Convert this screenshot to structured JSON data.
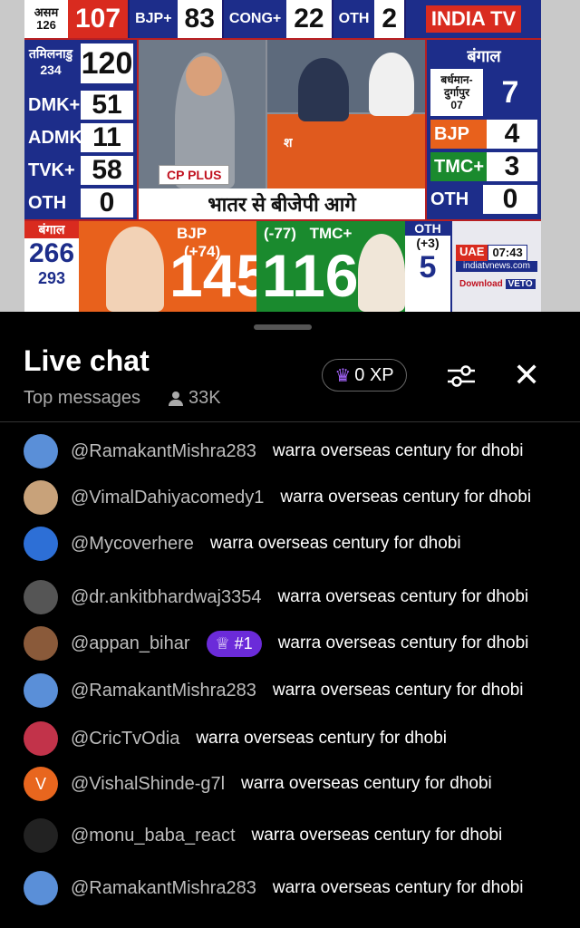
{
  "broadcast": {
    "top_bar": {
      "state_label": "असम",
      "state_total": "126",
      "state_value": "107",
      "cells": [
        {
          "label": "BJP+",
          "value": "83"
        },
        {
          "label": "CONG+",
          "value": "22"
        },
        {
          "label": "OTH",
          "value": "2"
        }
      ],
      "logo": "INDIA TV"
    },
    "tamilnadu": {
      "name": "तमिलनाडु",
      "total": "234",
      "lead": "120",
      "rows": [
        {
          "party": "DMK+",
          "seats": "51"
        },
        {
          "party": "ADMK+",
          "seats": "11"
        },
        {
          "party": "TVK+",
          "seats": "58"
        },
        {
          "party": "OTH",
          "seats": "0"
        }
      ]
    },
    "bengal_seat": {
      "title": "बंगाल",
      "seat_name": "बर्धमान-दुर्गापुर",
      "seat_no": "07",
      "value": "7",
      "rows": [
        {
          "party": "BJP",
          "seats": "4"
        },
        {
          "party": "TMC+",
          "seats": "3"
        },
        {
          "party": "OTH",
          "seats": "0"
        }
      ]
    },
    "studio": {
      "sponsor": "CP PLUS",
      "desk_text": "श",
      "headline": "भातर से बीजेपी आगे"
    },
    "bottom_bar": {
      "state_label": "बंगाल",
      "total": "266",
      "majority": "293",
      "bjp_label": "BJP",
      "bjp_change": "(+74)",
      "bjp_value": "145",
      "tmc_change": "(-77)",
      "tmc_label": "TMC+",
      "tmc_value": "116",
      "oth_label": "OTH",
      "oth_change": "(+3)",
      "oth_value": "5",
      "uae_label": "UAE",
      "time": "07:43",
      "site": "indiatvnews.com",
      "download": "Download",
      "veto": "VETO"
    }
  },
  "chat": {
    "title": "Live chat",
    "mode": "Top messages",
    "viewers": "33K",
    "xp": "0 XP",
    "messages": [
      {
        "author": "@RamakantMishra283",
        "text": "warra overseas century for dhobi",
        "avatar_color": "#5a8fd8"
      },
      {
        "author": "@VimalDahiyacomedy1",
        "text": "warra overseas century for dhobi",
        "avatar_color": "#c8a27a"
      },
      {
        "author": "@Mycoverhere",
        "text": "warra overseas century for dhobi",
        "avatar_color": "#2d6fd6"
      },
      {
        "author": "@dr.ankitbhardwaj3354",
        "text": "warra overseas century for dhobi",
        "avatar_color": "#555555"
      },
      {
        "author": "@appan_bihar",
        "badge": "#1",
        "text": "warra overseas century for dhobi",
        "avatar_color": "#8a5a3a"
      },
      {
        "author": "@RamakantMishra283",
        "text": "warra overseas century for dhobi",
        "avatar_color": "#5a8fd8"
      },
      {
        "author": "@CricTvOdia",
        "text": "warra overseas century for dhobi",
        "avatar_color": "#c2334a"
      },
      {
        "author": "@VishalShinde-g7l",
        "text": "warra overseas century for dhobi",
        "avatar_color": "#e8661e",
        "avatar_letter": "V"
      },
      {
        "author": "@monu_baba_react",
        "text": "warra overseas century for dhobi",
        "avatar_color": "#222222"
      },
      {
        "author": "@RamakantMishra283",
        "text": "warra overseas century for dhobi",
        "avatar_color": "#5a8fd8"
      }
    ]
  }
}
